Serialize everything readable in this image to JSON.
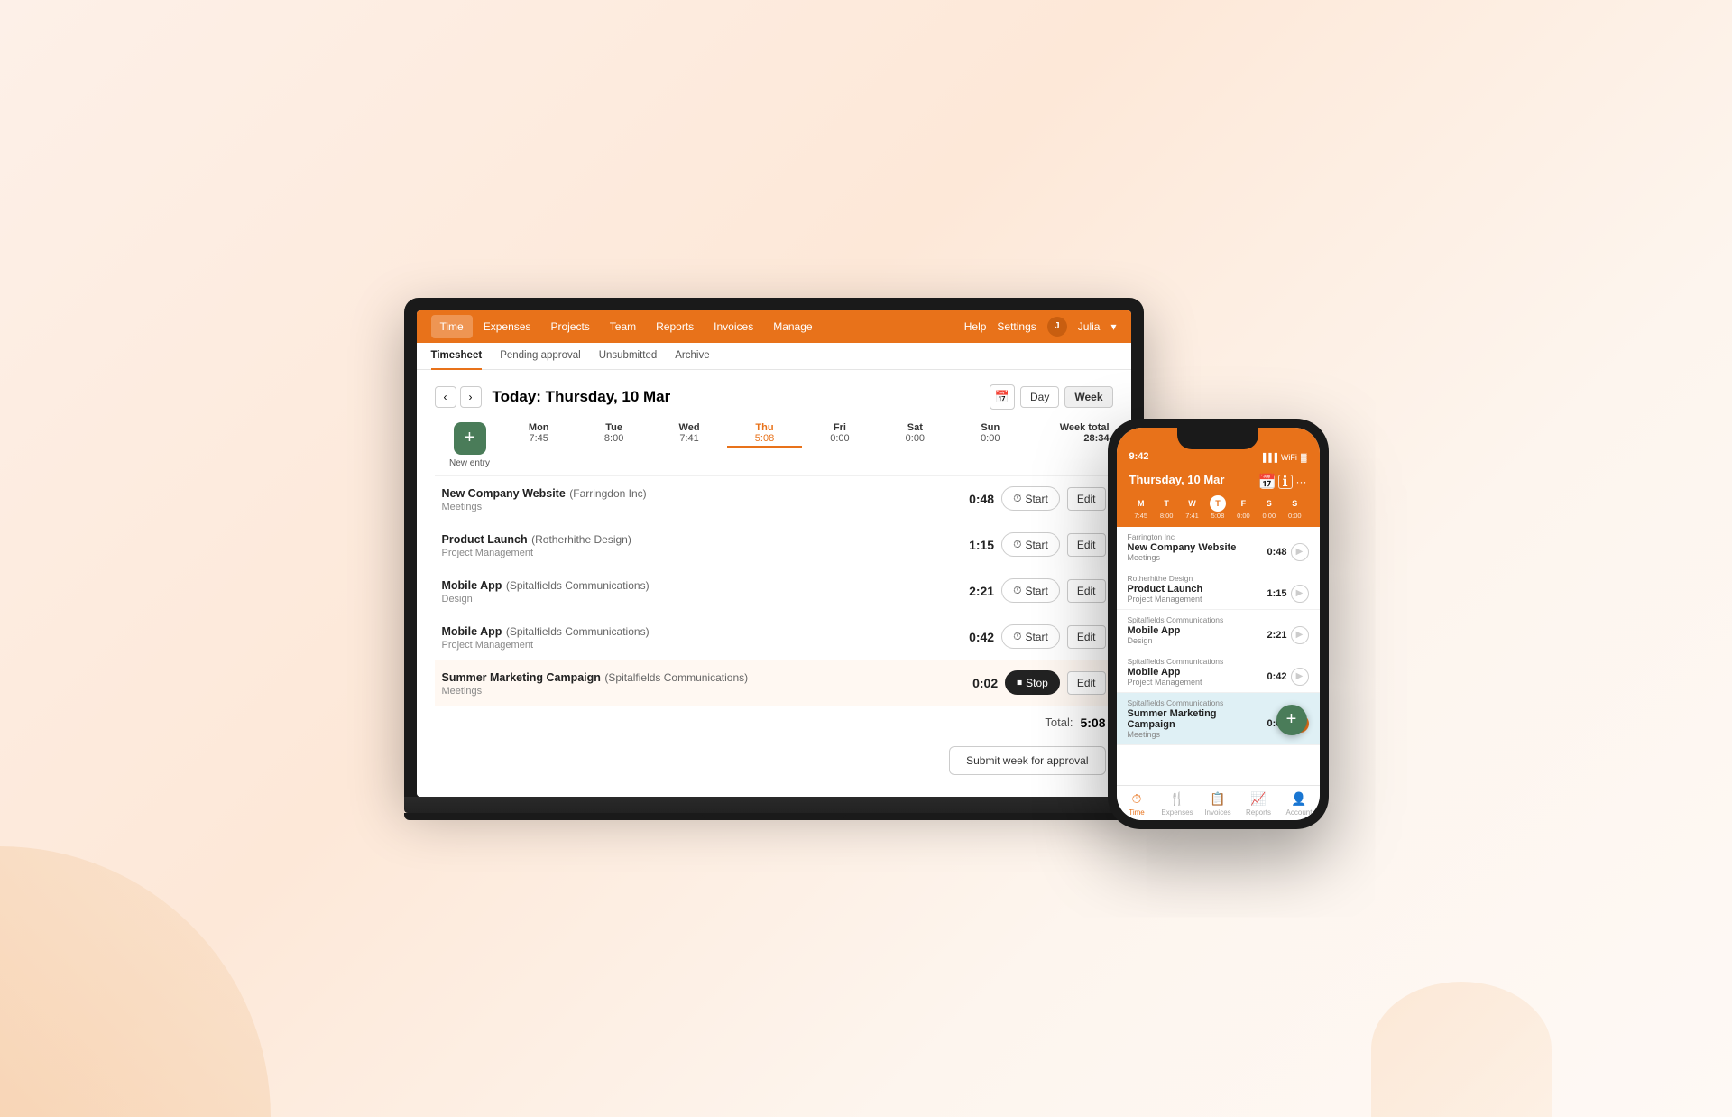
{
  "background": {
    "gradient": "linear-gradient(135deg, #fdf0e8, #fde8d8, #fdf5ee)"
  },
  "navbar": {
    "items": [
      "Time",
      "Expenses",
      "Projects",
      "Team",
      "Reports",
      "Invoices",
      "Manage"
    ],
    "active": "Time",
    "help_label": "Help",
    "settings_label": "Settings",
    "user_name": "Julia",
    "brand_color": "#e8721a"
  },
  "tabs": {
    "items": [
      "Timesheet",
      "Pending approval",
      "Unsubmitted",
      "Archive"
    ],
    "active": "Timesheet"
  },
  "timesheet": {
    "date_label": "Today: Thursday, 10 Mar",
    "days": [
      {
        "name": "Mon",
        "hours": "7:45",
        "active": false
      },
      {
        "name": "Tue",
        "hours": "8:00",
        "active": false
      },
      {
        "name": "Wed",
        "hours": "7:41",
        "active": false
      },
      {
        "name": "Thu",
        "hours": "5:08",
        "active": true
      },
      {
        "name": "Fri",
        "hours": "0:00",
        "active": false
      },
      {
        "name": "Sat",
        "hours": "0:00",
        "active": false
      },
      {
        "name": "Sun",
        "hours": "0:00",
        "active": false
      }
    ],
    "week_total_label": "Week total",
    "week_total": "28:34",
    "new_entry_label": "New entry",
    "entries": [
      {
        "project": "New Company Website",
        "client": "Farringdon Inc",
        "category": "Meetings",
        "duration": "0:48",
        "running": false,
        "action": "Start",
        "edit": "Edit"
      },
      {
        "project": "Product Launch",
        "client": "Rotherhithe Design",
        "category": "Project Management",
        "duration": "1:15",
        "running": false,
        "action": "Start",
        "edit": "Edit"
      },
      {
        "project": "Mobile App",
        "client": "Spitalfields Communications",
        "category": "Design",
        "duration": "2:21",
        "running": false,
        "action": "Start",
        "edit": "Edit"
      },
      {
        "project": "Mobile App",
        "client": "Spitalfields Communications",
        "category": "Project Management",
        "duration": "0:42",
        "running": false,
        "action": "Start",
        "edit": "Edit"
      },
      {
        "project": "Summer Marketing Campaign",
        "client": "Spitalfields Communications",
        "category": "Meetings",
        "duration": "0:02",
        "running": true,
        "action": "Stop",
        "edit": "Edit"
      }
    ],
    "total_label": "Total:",
    "total_value": "5:08",
    "submit_label": "Submit week for approval",
    "day_view_label": "Day",
    "week_view_label": "Week"
  },
  "phone": {
    "time": "9:42",
    "date_label": "Thursday, 10 Mar",
    "days": [
      {
        "letter": "M",
        "hours": "7:45",
        "active": false
      },
      {
        "letter": "T",
        "hours": "8:00",
        "active": false
      },
      {
        "letter": "W",
        "hours": "7:41",
        "active": false
      },
      {
        "letter": "T",
        "hours": "5:08",
        "active": true
      },
      {
        "letter": "F",
        "hours": "0:00",
        "active": false
      },
      {
        "letter": "S",
        "hours": "0:00",
        "active": false
      },
      {
        "letter": "S",
        "hours": "0:00",
        "active": false
      }
    ],
    "entries": [
      {
        "client": "Farrington Inc",
        "project": "New Company Website",
        "category": "Meetings",
        "duration": "0:48",
        "running": false
      },
      {
        "client": "Rotherhithe Design",
        "project": "Product Launch",
        "category": "Project Management",
        "duration": "1:15",
        "running": false
      },
      {
        "client": "Spitalfields Communications",
        "project": "Mobile App",
        "category": "Design",
        "duration": "2:21",
        "running": false
      },
      {
        "client": "Spitalfields Communications",
        "project": "Mobile App",
        "category": "Project Management",
        "duration": "0:42",
        "running": false
      },
      {
        "client": "Spitalfields Communications",
        "project": "Summer Marketing Campaign",
        "category": "Meetings",
        "duration": "0:02",
        "running": true
      }
    ],
    "bottom_nav": [
      {
        "icon": "⏱",
        "label": "Time",
        "active": true
      },
      {
        "icon": "🍴",
        "label": "Expenses",
        "active": false
      },
      {
        "icon": "📋",
        "label": "Invoices",
        "active": false
      },
      {
        "icon": "📈",
        "label": "Reports",
        "active": false
      },
      {
        "icon": "👤",
        "label": "Account",
        "active": false
      }
    ]
  }
}
